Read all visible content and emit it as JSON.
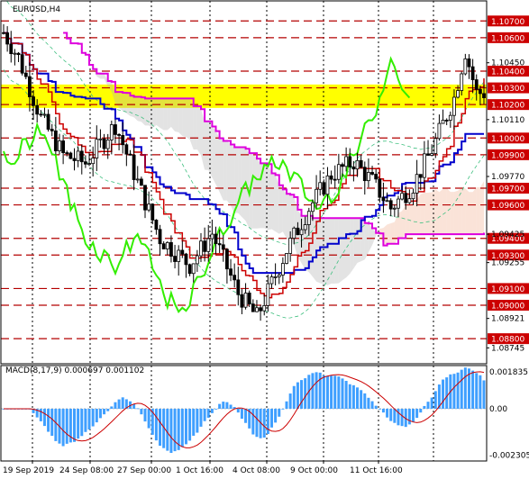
{
  "chart_data": {
    "type": "candlestick",
    "title": "EURUSD,H4",
    "price_axis": {
      "range": [
        1.0872,
        1.0712
      ],
      "ticks": [
        "1.10700",
        "1.10600",
        "1.10450",
        "1.10400",
        "1.10300",
        "1.10200",
        "1.10110",
        "1.10000",
        "1.09900",
        "1.09770",
        "1.09700",
        "1.09600",
        "1.09425",
        "1.09400",
        "1.09300",
        "1.09255",
        "1.09100",
        "1.09000",
        "1.08921",
        "1.08800",
        "1.08745"
      ],
      "levels": [
        1.107,
        1.106,
        1.104,
        1.103,
        1.102,
        1.1,
        1.099,
        1.097,
        1.096,
        1.094,
        1.093,
        1.091,
        1.09,
        1.088
      ],
      "level_labels": [
        "1.10700",
        "1.10600",
        "1.10400",
        "1.10300",
        "1.10200",
        "1.10000",
        "1.09900",
        "1.09700",
        "1.09600",
        "1.09400",
        "1.09300",
        "1.09100",
        "1.09000",
        "1.08800"
      ],
      "highlight_zone": [
        1.1032,
        1.1018
      ]
    },
    "x_axis": {
      "labels": [
        "19 Sep 2019",
        "24 Sep 08:00",
        "27 Sep 00:00",
        "1 Oct 16:00",
        "4 Oct 08:00",
        "9 Oct 00:00",
        "11 Oct 16:00"
      ]
    },
    "macd": {
      "label": "MACD(8,17,9) 0.000697 0.001102",
      "ticks": [
        "0.001835",
        "0.00",
        "-0.002305"
      ],
      "range": [
        0.00215,
        -0.0026
      ]
    },
    "colors": {
      "level_line": "#b40000",
      "badge": "#cc0000",
      "zone": "#ffff00",
      "tenkan": "#cc0000",
      "kijun": "#0000cc",
      "senkou_b": "#dd00dd",
      "chikou": "#33ee00",
      "cloud_a": "#f0b090",
      "cloud_b": "#b0b0b0",
      "bollinger": "#40c080",
      "macd_hist": "#3f9fff",
      "macd_signal": "#cc0000"
    }
  }
}
